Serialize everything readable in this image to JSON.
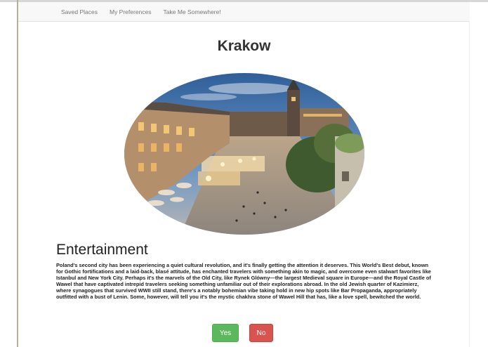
{
  "nav": {
    "items": [
      {
        "label": "Saved Places"
      },
      {
        "label": "My Preferences"
      },
      {
        "label": "Take Me Somewhere!"
      }
    ]
  },
  "page": {
    "title": "Krakow"
  },
  "section": {
    "heading": "Entertainment",
    "text": "Poland's second city has been experiencing a quiet cultural revolution, and it's finally getting the attention it deserves. This World's Best debut, known for Gothic fortifications and a laid-back, blasé attitude, has enchanted travelers with something akin to magic, and overcome even stalwart favorites like Istanbul and New York City. Perhaps it's the marvels of the Old City, like Rynek Glówny—the largest Medieval square in Europe—and the Royal Castle of Wawel that have captivated intrepid travelers seeking something unfamiliar out of their explorations abroad. In the old Jewish quarter of Kazimierz, where synagogues that survived WWII still stand, there's a notably bohemian vibe taking hold in new hip spots like Bar Propaganda, appropriately outfitted with a bust of Lenin. Some, however, will tell you it's the mystic chakhra stone of Wawel Hill that has, like a love spell, bewitched the world."
  },
  "buttons": {
    "yes_label": "Yes",
    "no_label": "No"
  },
  "colors": {
    "yes": "#5cb85c",
    "no": "#d9534f",
    "navbar_bg": "#f8f8f8"
  }
}
